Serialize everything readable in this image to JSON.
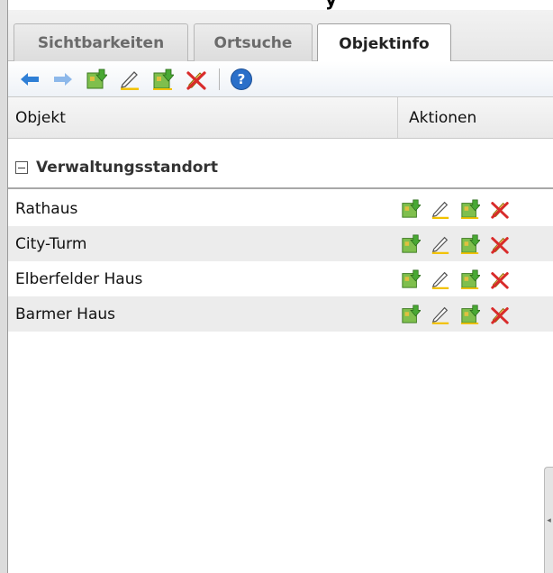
{
  "tabs": [
    {
      "label": "Sichtbarkeiten",
      "active": false
    },
    {
      "label": "Ortsuche",
      "active": false
    },
    {
      "label": "Objektinfo",
      "active": true
    }
  ],
  "toolbar": {
    "icons": [
      "back-arrow-icon",
      "forward-arrow-icon",
      "add-to-map-icon",
      "edit-pencil-icon",
      "export-map-icon",
      "delete-icon",
      "help-icon"
    ]
  },
  "grid": {
    "columns": {
      "objekt": "Objekt",
      "aktionen": "Aktionen"
    },
    "group": {
      "label": "Verwaltungsstandort",
      "collapsed": false
    },
    "rows": [
      {
        "name": "Rathaus"
      },
      {
        "name": "City-Turm"
      },
      {
        "name": "Elberfelder Haus"
      },
      {
        "name": "Barmer Haus"
      }
    ]
  },
  "colors": {
    "arrow_blue": "#2f7fd6",
    "map_green": "#49a834",
    "pencil_yellow": "#f2c200",
    "delete_red": "#d92b2b",
    "help_blue": "#2a6fc9"
  }
}
